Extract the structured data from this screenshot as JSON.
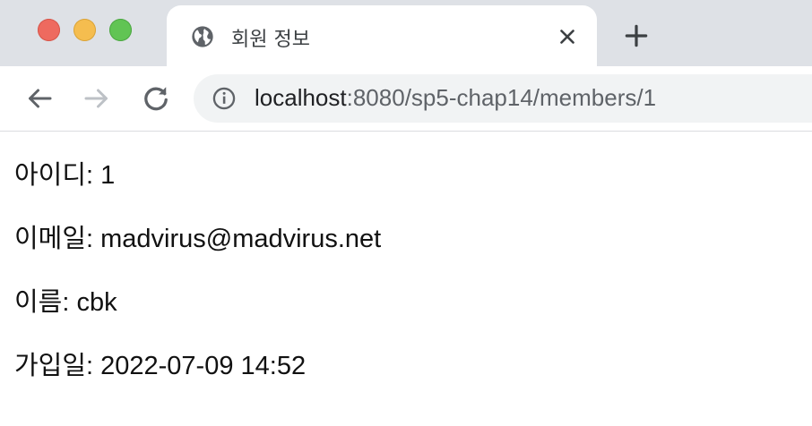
{
  "window": {
    "controls": [
      "close",
      "minimize",
      "zoom"
    ]
  },
  "tab": {
    "title": "회원 정보",
    "favicon": "globe-icon"
  },
  "toolbar": {
    "url_host": "localhost",
    "url_path": ":8080/sp5-chap14/members/1"
  },
  "member": {
    "fields": [
      {
        "label": "아이디",
        "value": "1"
      },
      {
        "label": "이메일",
        "value": "madvirus@madvirus.net"
      },
      {
        "label": "이름",
        "value": "cbk"
      },
      {
        "label": "가입일",
        "value": "2022-07-09 14:52"
      }
    ]
  },
  "colors": {
    "titlebar": "#dee1e6",
    "omnibox": "#f1f3f4",
    "close": "#ee6a5f",
    "minimize": "#f5bd4f",
    "zoom": "#61c454"
  }
}
